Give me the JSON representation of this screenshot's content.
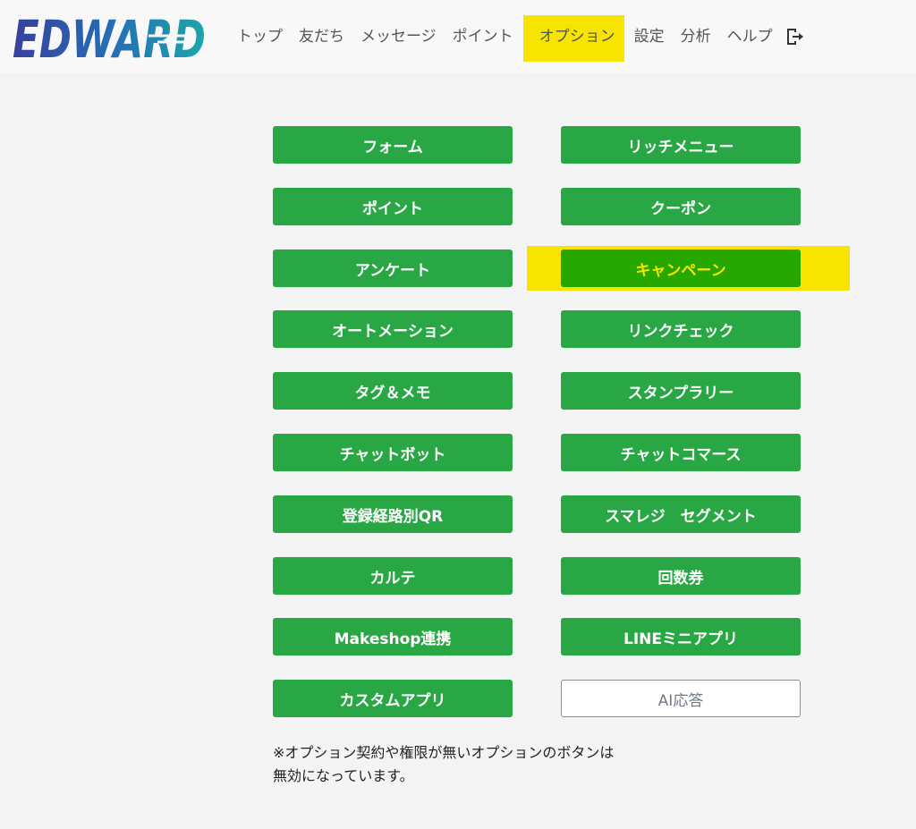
{
  "brand": {
    "logo_text": "EDWARD"
  },
  "nav": {
    "items": [
      {
        "label": "トップ"
      },
      {
        "label": "友だち"
      },
      {
        "label": "メッセージ"
      },
      {
        "label": "ポイント"
      },
      {
        "label": "オプション",
        "active": true
      },
      {
        "label": "設定"
      },
      {
        "label": "分析"
      },
      {
        "label": "ヘルプ"
      }
    ],
    "logout_icon": "logout-icon"
  },
  "options": {
    "left": [
      "フォーム",
      "ポイント",
      "アンケート",
      "オートメーション",
      "タグ＆メモ",
      "チャットボット",
      "登録経路別QR",
      "カルテ",
      "Makeshop連携",
      "カスタムアプリ"
    ],
    "right": [
      "リッチメニュー",
      "クーポン",
      "キャンペーン",
      "リンクチェック",
      "スタンプラリー",
      "チャットコマース",
      "スマレジ　セグメント",
      "回数券",
      "LINEミニアプリ",
      "AI応答"
    ],
    "selected": "キャンペーン",
    "disabled": [
      "AI応答"
    ]
  },
  "notice": {
    "line1": "※オプション契約や権限が無いオプションのボタンは",
    "line2": "無効になっています。"
  },
  "colors": {
    "button_green": "#2aa745",
    "highlight_yellow": "#f7e400",
    "background": "#f4f4f4"
  }
}
